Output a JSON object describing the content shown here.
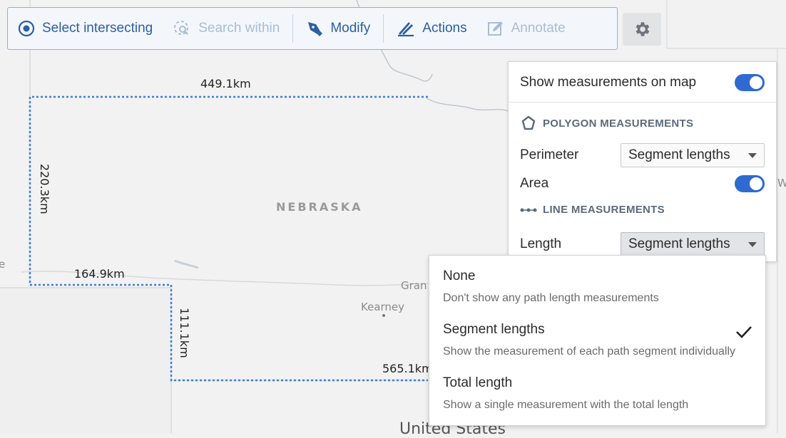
{
  "toolbar": {
    "select_intersecting": "Select intersecting",
    "search_within": "Search within",
    "modify": "Modify",
    "actions": "Actions",
    "annotate": "Annotate"
  },
  "map": {
    "state": "NEBRASKA",
    "cities": [
      "Gran",
      "Kearney"
    ],
    "country": "United States",
    "edge_fragment": "W",
    "left_fragment": "e",
    "measurements": {
      "top": "449.1km",
      "left": "220.3km",
      "mid_left": "164.9km",
      "step": "111.1km",
      "bottom": "565.1km"
    }
  },
  "settings": {
    "show_measurements": "Show measurements on map",
    "polygon_heading": "POLYGON MEASUREMENTS",
    "perimeter_label": "Perimeter",
    "perimeter_value": "Segment lengths",
    "area_label": "Area",
    "line_heading": "LINE MEASUREMENTS",
    "length_label": "Length",
    "length_value": "Segment lengths"
  },
  "dropdown": {
    "options": [
      {
        "label": "None",
        "description": "Don't show any path length measurements"
      },
      {
        "label": "Segment lengths",
        "description": "Show the measurement of each path segment individually"
      },
      {
        "label": "Total length",
        "description": "Show a single measurement with the total length"
      }
    ],
    "selected": "Segment lengths"
  },
  "colors": {
    "accent": "#2f6ad0",
    "toolbar_text": "#2d5ea0",
    "toolbar_disabled": "#a9bcd6",
    "polygon_stroke": "#3b7ddd"
  }
}
